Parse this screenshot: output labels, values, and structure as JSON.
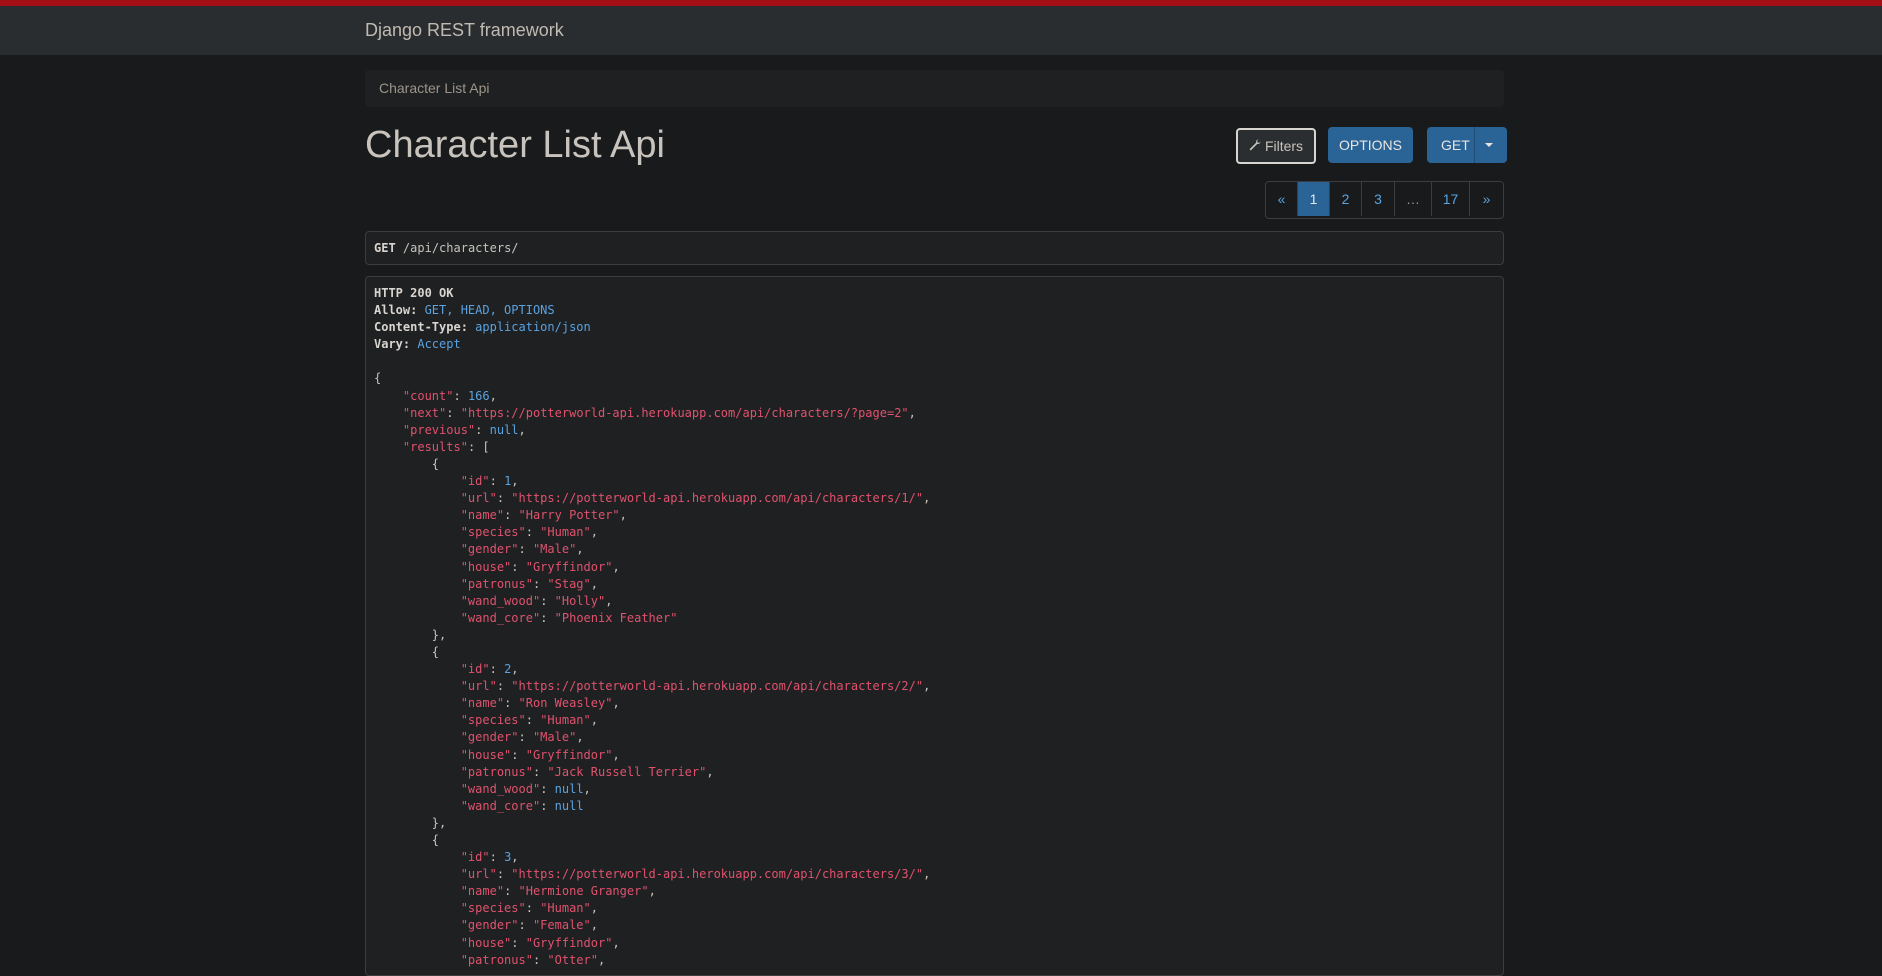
{
  "navbar": {
    "brand": "Django REST framework"
  },
  "breadcrumb": {
    "current": "Character List Api"
  },
  "page": {
    "title": "Character List Api"
  },
  "toolbar": {
    "filters_label": "Filters",
    "options_label": "OPTIONS",
    "get_label": "GET"
  },
  "pagination": {
    "prev": "«",
    "pages": [
      "1",
      "2",
      "3"
    ],
    "ellipsis": "…",
    "last": "17",
    "next": "»",
    "active": "1"
  },
  "request": {
    "method": "GET",
    "path": "/api/characters/"
  },
  "response": {
    "status": "HTTP 200 OK",
    "headers": [
      {
        "key": "Allow",
        "value": "GET, HEAD, OPTIONS"
      },
      {
        "key": "Content-Type",
        "value": "application/json"
      },
      {
        "key": "Vary",
        "value": "Accept"
      }
    ],
    "count": "166",
    "next": "\"https://potterworld-api.herokuapp.com/api/characters/?page=2\"",
    "previous": "null",
    "results": [
      {
        "id": "1",
        "url": "\"https://potterworld-api.herokuapp.com/api/characters/1/\"",
        "name": "\"Harry Potter\"",
        "species": "\"Human\"",
        "gender": "\"Male\"",
        "house": "\"Gryffindor\"",
        "patronus": "\"Stag\"",
        "wand_wood": "\"Holly\"",
        "wand_core": "\"Phoenix Feather\""
      },
      {
        "id": "2",
        "url": "\"https://potterworld-api.herokuapp.com/api/characters/2/\"",
        "name": "\"Ron Weasley\"",
        "species": "\"Human\"",
        "gender": "\"Male\"",
        "house": "\"Gryffindor\"",
        "patronus": "\"Jack Russell Terrier\"",
        "wand_wood": "null",
        "wand_core": "null"
      },
      {
        "id": "3",
        "url": "\"https://potterworld-api.herokuapp.com/api/characters/3/\"",
        "name": "\"Hermione Granger\"",
        "species": "\"Human\"",
        "gender": "\"Female\"",
        "house": "\"Gryffindor\"",
        "patronus": "\"Otter\""
      }
    ]
  }
}
